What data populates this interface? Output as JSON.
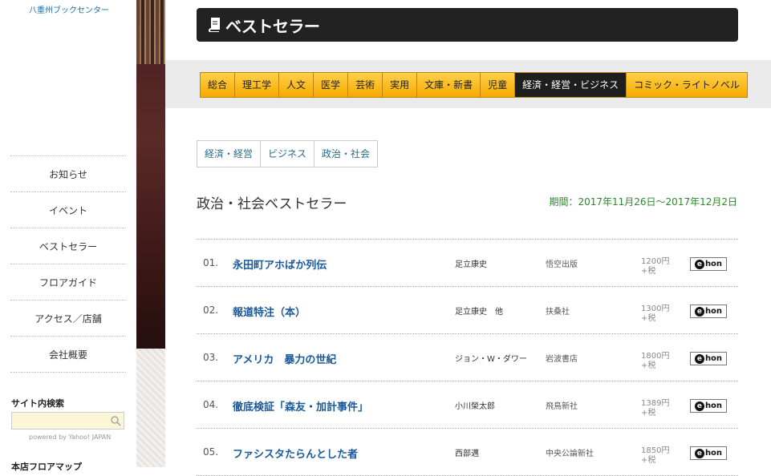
{
  "sidebar": {
    "logo_text": "八重州ブックセンター",
    "items": [
      {
        "label": "お知らせ"
      },
      {
        "label": "イベント"
      },
      {
        "label": "ベストセラー"
      },
      {
        "label": "フロアガイド"
      },
      {
        "label": "アクセス／店舗"
      },
      {
        "label": "会社概要"
      }
    ],
    "search_title": "サイト内検索",
    "search_placeholder": "",
    "powered_by": "powered by Yahoo! JAPAN",
    "more_heading": "本店フロアマップ"
  },
  "header": {
    "title": "ベストセラー",
    "icon": "book-icon"
  },
  "categories": [
    {
      "label": "総合"
    },
    {
      "label": "理工学"
    },
    {
      "label": "人文"
    },
    {
      "label": "医学"
    },
    {
      "label": "芸術"
    },
    {
      "label": "実用"
    },
    {
      "label": "文庫・新書"
    },
    {
      "label": "児童"
    },
    {
      "label": "経済・経営・ビジネス",
      "active": true
    },
    {
      "label": "コミック・ライトノベル"
    }
  ],
  "subcategories": [
    {
      "label": "経済・経営"
    },
    {
      "label": "ビジネス"
    },
    {
      "label": "政治・社会"
    }
  ],
  "section": {
    "title": "政治・社会ベストセラー",
    "period": "期間：2017年11月26日～2017年12月2日"
  },
  "books": [
    {
      "rank": "01.",
      "title": "永田町アホばか列伝",
      "author": "足立康史",
      "publisher": "悟空出版",
      "price": "1200円",
      "tax": "+税"
    },
    {
      "rank": "02.",
      "title": "報道特注（本）",
      "author": "足立康史　他",
      "publisher": "扶桑社",
      "price": "1300円",
      "tax": "+税"
    },
    {
      "rank": "03.",
      "title": "アメリカ　暴力の世紀",
      "author": "ジョン・W・ダワー",
      "publisher": "岩波書店",
      "price": "1800円",
      "tax": "+税"
    },
    {
      "rank": "04.",
      "title": "徹底検証「森友・加計事件」",
      "author": "小川榮太郎",
      "publisher": "飛鳥新社",
      "price": "1389円",
      "tax": "+税"
    },
    {
      "rank": "05.",
      "title": "ファシスタたらんとした者",
      "author": "西部邁",
      "publisher": "中央公論新社",
      "price": "1850円",
      "tax": "+税"
    }
  ],
  "ehon_label": "hon",
  "colors": {
    "accent": "#f7a800",
    "title_bar": "#222222",
    "period": "#2a8a2a",
    "link": "#1a5a9a"
  }
}
